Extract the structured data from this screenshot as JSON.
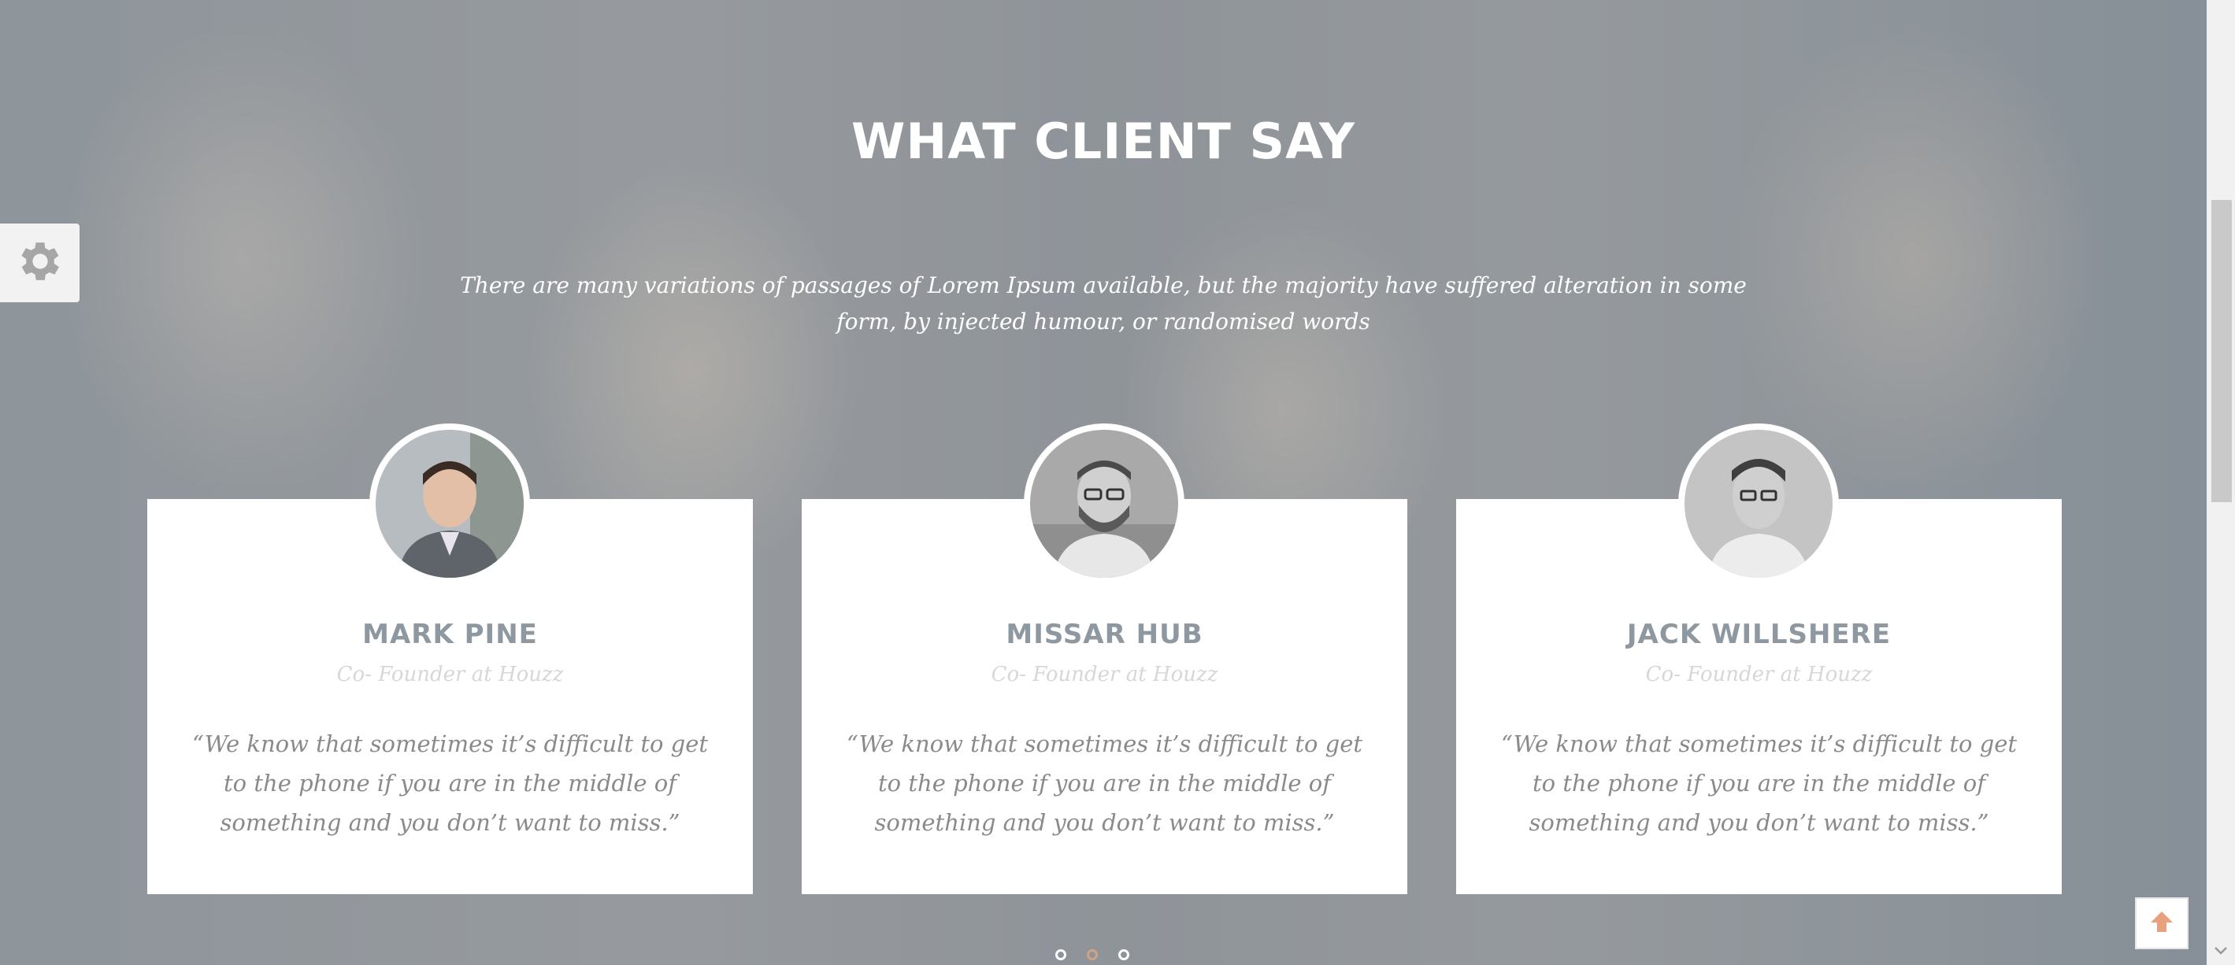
{
  "section": {
    "title": "WHAT CLIENT SAY",
    "subtitle": "There are many variations of passages of Lorem Ipsum available, but the majority have suffered alteration in some form, by injected humour, or randomised words"
  },
  "testimonials": [
    {
      "name": "MARK PINE",
      "role": "Co- Founder at Houzz",
      "quote": "“We know that sometimes it’s difficult to get to the phone if you are in the middle of something and you don’t want to miss.”"
    },
    {
      "name": "MISSAR HUB",
      "role": "Co- Founder at Houzz",
      "quote": "“We know that sometimes it’s difficult to get to the phone if you are in the middle of something and you don’t want to miss.”"
    },
    {
      "name": "JACK WILLSHERE",
      "role": "Co- Founder at Houzz",
      "quote": "“We know that sometimes it’s difficult to get to the phone if you are in the middle of something and you don’t want to miss.”"
    }
  ],
  "carousel": {
    "pages": 3,
    "active_page": 2
  },
  "colors": {
    "accent": "#d4a283",
    "name_text": "#8e98a0"
  },
  "icons": {
    "settings": "gear-icon",
    "scroll_top": "arrow-up-icon"
  }
}
